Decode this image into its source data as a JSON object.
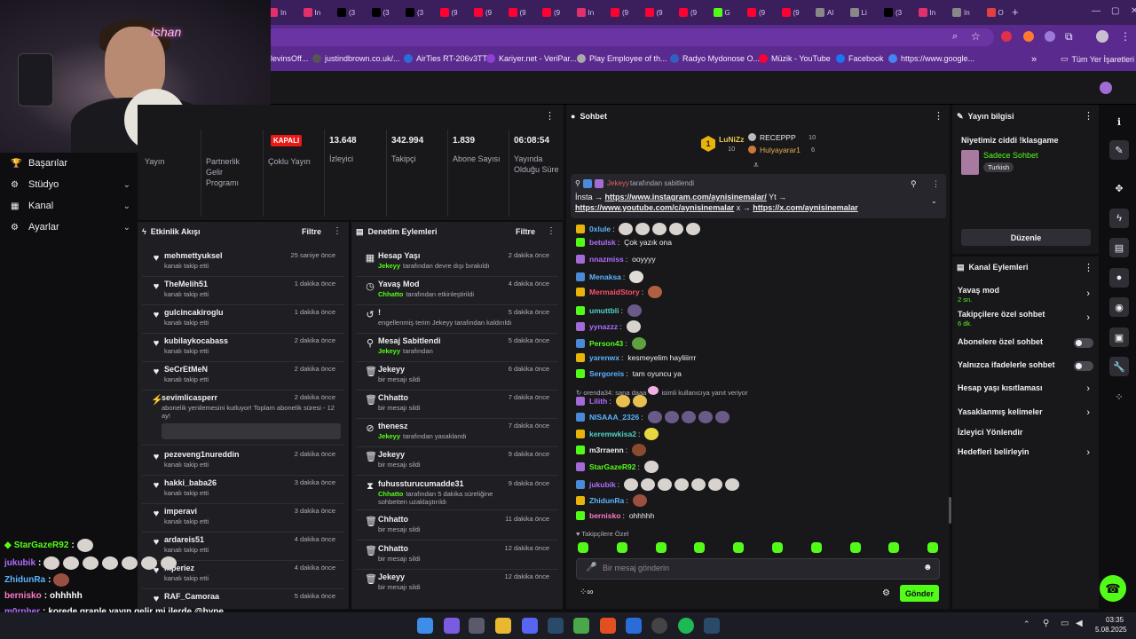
{
  "browser": {
    "tabs": [
      {
        "label": "In",
        "color": "#e1306c"
      },
      {
        "label": "In",
        "color": "#e1306c"
      },
      {
        "label": "(3",
        "color": "#000000"
      },
      {
        "label": "(3",
        "color": "#000000"
      },
      {
        "label": "(3",
        "color": "#000000"
      },
      {
        "label": "(9",
        "color": "#ff0033"
      },
      {
        "label": "(9",
        "color": "#ff0033"
      },
      {
        "label": "(9",
        "color": "#ff0033"
      },
      {
        "label": "(9",
        "color": "#ff0033"
      },
      {
        "label": "In",
        "color": "#e1306c"
      },
      {
        "label": "(9",
        "color": "#ff0033"
      },
      {
        "label": "(9",
        "color": "#ff0033"
      },
      {
        "label": "(9",
        "color": "#ff0033"
      },
      {
        "label": "G",
        "color": "#53fc18"
      },
      {
        "label": "(9",
        "color": "#ff0033"
      },
      {
        "label": "(9",
        "color": "#ff0033"
      },
      {
        "label": "Al",
        "color": "#888888"
      },
      {
        "label": "Li",
        "color": "#888888"
      },
      {
        "label": "(3",
        "color": "#000000"
      },
      {
        "label": "In",
        "color": "#e1306c"
      },
      {
        "label": "In",
        "color": "#888888"
      },
      {
        "label": "O",
        "color": "#e04040"
      }
    ],
    "new_tab": "+",
    "bookmarks": [
      "levinsOff...",
      "justindbrown.co.uk/...",
      "AirTies RT-206v3TT",
      "Kariyer.net - VeriPar...",
      "Play Employee of th...",
      "Radyo Mydonose O...",
      "Müzik - YouTube",
      "Facebook",
      "https://www.google..."
    ],
    "bookmarks_more": "»",
    "all_bookmarks": "Tüm Yer İşaretleri"
  },
  "webcam": {
    "neon": "Ishan"
  },
  "sidebar": {
    "items": [
      {
        "label": "Başarılar",
        "chevron": false
      },
      {
        "label": "Stüdyo",
        "chevron": true
      },
      {
        "label": "Kanal",
        "chevron": true
      },
      {
        "label": "Ayarlar",
        "chevron": true
      }
    ]
  },
  "stats": {
    "offline_badge": "KAPALI",
    "labels": [
      "Yayın",
      "Partnerlik Gelir Programı",
      "Çoklu Yayın",
      "İzleyici",
      "Takipçi",
      "Abone Sayısı",
      "Yayında Olduğu Süre"
    ],
    "values": [
      "13.648",
      "342.994",
      "1.839",
      "06:08:54"
    ]
  },
  "activity": {
    "title": "Etkinlik Akışı",
    "filter": "Filtre",
    "items": [
      {
        "name": "mehmettyuksel",
        "sub": "kanalı takip etti",
        "time": "25 saniye önce"
      },
      {
        "name": "TheMelih51",
        "sub": "kanalı takip etti",
        "time": "1 dakika önce"
      },
      {
        "name": "gulcincakiroglu",
        "sub": "kanalı takip etti",
        "time": "1 dakika önce"
      },
      {
        "name": "kubilaykocabass",
        "sub": "kanalı takip etti",
        "time": "2 dakika önce"
      },
      {
        "name": "SeCrEtMeN",
        "sub": "kanalı takip etti",
        "time": "2 dakika önce"
      },
      {
        "name": "sevimlicasperr",
        "sub": "abonelik yenilemesini kutluyor! Toplam abonelik süresi - 12 ay!",
        "time": "2 dakika önce"
      },
      {
        "name": "pezeveng1nureddin",
        "sub": "kanalı takip etti",
        "time": "2 dakika önce"
      },
      {
        "name": "hakki_baba26",
        "sub": "kanalı takip etti",
        "time": "3 dakika önce"
      },
      {
        "name": "imperavi",
        "sub": "kanalı takip etti",
        "time": "3 dakika önce"
      },
      {
        "name": "ardareis51",
        "sub": "kanalı takip etti",
        "time": "4 dakika önce"
      },
      {
        "name": "mperiez",
        "sub": "kanalı takip etti",
        "time": "4 dakika önce"
      },
      {
        "name": "RAF_Camoraa",
        "sub": "",
        "time": "5 dakika önce"
      }
    ]
  },
  "moderation": {
    "title": "Denetim Eylemleri",
    "filter": "Filtre",
    "items": [
      {
        "name": "Hesap Yaşı",
        "actor": "Jekeyy",
        "sub": "tarafından devre dışı bırakıldı",
        "time": "2 dakika önce",
        "icon": "▦"
      },
      {
        "name": "Yavaş Mod",
        "actor": "Chhatto",
        "sub": "tarafından etkinleştirildi",
        "time": "4 dakika önce",
        "icon": "◷"
      },
      {
        "name": "!",
        "actor": "",
        "sub": "engellenmiş terim Jekeyy tarafından kaldırıldı",
        "time": "5 dakika önce",
        "icon": "↺"
      },
      {
        "name": "Mesaj Sabitlendi",
        "actor": "Jekeyy",
        "sub": "tarafından",
        "time": "5 dakika önce",
        "icon": "⚲"
      },
      {
        "name": "Jekeyy",
        "actor": "",
        "sub": "bir mesajı sildi",
        "time": "6 dakika önce",
        "icon": "🗑"
      },
      {
        "name": "Chhatto",
        "actor": "",
        "sub": "bir mesajı sildi",
        "time": "7 dakika önce",
        "icon": "🗑"
      },
      {
        "name": "thenesz",
        "actor": "Jekeyy",
        "sub": "tarafından yasaklandı",
        "time": "7 dakika önce",
        "icon": "⊘"
      },
      {
        "name": "Jekeyy",
        "actor": "",
        "sub": "bir mesajı sildi",
        "time": "9 dakika önce",
        "icon": "🗑"
      },
      {
        "name": "fuhussturucumadde31",
        "actor": "Chhatto",
        "sub": "tarafından 5 dakika süreliğine sohbetten uzaklaştırıldı",
        "time": "9 dakika önce",
        "icon": "⧗"
      },
      {
        "name": "Chhatto",
        "actor": "",
        "sub": "bir mesajı sildi",
        "time": "11 dakika önce",
        "icon": "🗑"
      },
      {
        "name": "Chhatto",
        "actor": "",
        "sub": "bir mesajı sildi",
        "time": "12 dakika önce",
        "icon": "🗑"
      },
      {
        "name": "Jekeyy",
        "actor": "",
        "sub": "bir mesajı sildi",
        "time": "12 dakika önce",
        "icon": "🗑"
      }
    ]
  },
  "chat": {
    "title": "Sohbet",
    "leaderboard": {
      "first": {
        "rank": "1",
        "name": "LuNiZz",
        "count": "10"
      },
      "second": {
        "name": "RECEPPP",
        "count": "10"
      },
      "third": {
        "name": "Hulyayarar1",
        "count": "6"
      }
    },
    "pinned": {
      "author": "Jekeyy",
      "by": "tarafından sabitlendi",
      "line1_prefix": "İnsta →",
      "line1_link": "https://www.instagram.com/aynisinemalar/",
      "line1_suffix": "Yt →",
      "line2_link1": "https://www.youtube.com/c/aynisinemalar",
      "line2_mid": "x →",
      "line2_link2": "https://x.com/aynisinemalar"
    },
    "messages": [
      {
        "user": "0xlule",
        "color": "#5ab4ff",
        "text": "",
        "emotes": 5
      },
      {
        "user": "betulsk",
        "color": "#b06cff",
        "text": "Çok yazık ona",
        "emotes": 0
      },
      {
        "user": "nnazmiss",
        "color": "#b06cff",
        "text": "ooyyyy",
        "emotes": 0
      },
      {
        "user": "Menaksa",
        "color": "#5ab4ff",
        "text": "",
        "emotes": 1
      },
      {
        "user": "MermaidStory",
        "color": "#ff4f6a",
        "text": "",
        "emotes": 1
      },
      {
        "user": "umuttbli",
        "color": "#4fd1c5",
        "text": "",
        "emotes": 1
      },
      {
        "user": "yynazzz",
        "color": "#b06cff",
        "text": "",
        "emotes": 1
      },
      {
        "user": "Person43",
        "color": "#53fc18",
        "text": "",
        "emotes": 1
      },
      {
        "user": "yarenwx",
        "color": "#5ab4ff",
        "text": "kesmeyelim hayliiirrr",
        "emotes": 0
      },
      {
        "user": "Sergoreis",
        "color": "#5ab4ff",
        "text": "tam oyuncu ya",
        "emotes": 0
      },
      {
        "user": "Lilith",
        "color": "#b06cff",
        "text": "",
        "emotes": 2
      },
      {
        "user": "NISAAA_2326",
        "color": "#5ab4ff",
        "text": "",
        "emotes": 5
      },
      {
        "user": "keremwkisa2",
        "color": "#4fd1c5",
        "text": "",
        "emotes": 1
      },
      {
        "user": "m3rraenn",
        "color": "#efeff1",
        "text": "",
        "emotes": 1
      },
      {
        "user": "StarGazeR92",
        "color": "#53fc18",
        "text": "",
        "emotes": 1
      },
      {
        "user": "jukubik",
        "color": "#b06cff",
        "text": "",
        "emotes": 7
      },
      {
        "user": "ZhidunRa",
        "color": "#5ab4ff",
        "text": "",
        "emotes": 1
      },
      {
        "user": "bernisko",
        "color": "#ff7ac8",
        "text": "ohhhhh",
        "emotes": 0
      }
    ],
    "reply_note": "orenda34: sana daaa",
    "reply_suffix": "isimli kullanıcıya yanıt veriyor",
    "followers_only": "Takipçilere Özel",
    "input_placeholder": "Bir mesaj gönderin",
    "send": "Gönder"
  },
  "stream_info": {
    "title": "Yayın bilgisi",
    "stream_title": "Niyetimiz ciddi !klasgame",
    "category": "Sadece Sohbet",
    "tag": "Turkish",
    "edit": "Düzenle"
  },
  "channel_actions": {
    "title": "Kanal Eylemleri",
    "items": [
      {
        "label": "Yavaş mod",
        "sub": "2 sn.",
        "control": "chevron"
      },
      {
        "label": "Takipçilere özel sohbet",
        "sub": "6 dk.",
        "control": "chevron"
      },
      {
        "label": "Abonelere özel sohbet",
        "sub": "",
        "control": "toggle"
      },
      {
        "label": "Yalnızca ifadelerle sohbet",
        "sub": "",
        "control": "toggle"
      },
      {
        "label": "Hesap yaşı kısıtlaması",
        "sub": "",
        "control": "chevron"
      },
      {
        "label": "Yasaklanmış kelimeler",
        "sub": "",
        "control": "chevron"
      },
      {
        "label": "İzleyici Yönlendir",
        "sub": "",
        "control": "none"
      },
      {
        "label": "Hedefleri belirleyin",
        "sub": "",
        "control": "chevron"
      }
    ]
  },
  "overlay_chat": [
    {
      "user": "StarGazeR92",
      "color": "#53fc18",
      "text": "",
      "emotes": 1
    },
    {
      "user": "jukubik",
      "color": "#b06cff",
      "text": "",
      "emotes": 7
    },
    {
      "user": "ZhidunRa",
      "color": "#5ab4ff",
      "text": "",
      "emotes": 1
    },
    {
      "user": "bernisko",
      "color": "#ff7ac8",
      "text": "ohhhhh",
      "emotes": 0
    },
    {
      "user": "m0rpher",
      "color": "#b06cff",
      "text": "korede granle yayın gelir mi ilerde @hype",
      "emotes": 0
    }
  ],
  "taskbar": {
    "time": "03:35",
    "date": "5.08.2025"
  },
  "colors": {
    "kick_green": "#53fc18",
    "brand_purple": "#5b2a8f"
  }
}
